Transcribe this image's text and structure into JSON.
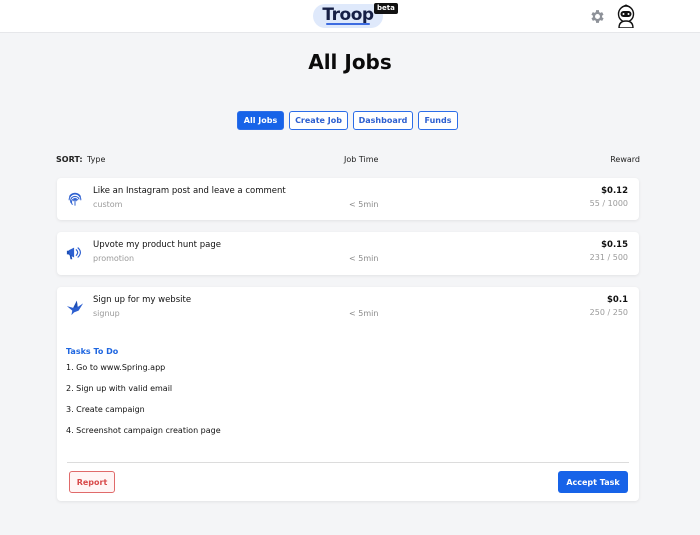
{
  "header": {
    "logo_text": "Troop",
    "beta_label": "beta",
    "settings_icon": "gear-icon",
    "avatar_icon": "astronaut-avatar-icon"
  },
  "page_title": "All Jobs",
  "tabs": [
    {
      "label": "All Jobs",
      "active": true
    },
    {
      "label": "Create Job",
      "active": false
    },
    {
      "label": "Dashboard",
      "active": false
    },
    {
      "label": "Funds",
      "active": false
    }
  ],
  "sort": {
    "label": "SORT:",
    "columns": [
      "Type",
      "Job Time",
      "Reward"
    ]
  },
  "jobs": [
    {
      "icon": "fingerprint-icon",
      "title": "Like an Instagram post and leave a comment",
      "type": "custom",
      "time": "< 5min",
      "reward": "$0.12",
      "count": "55 / 1000"
    },
    {
      "icon": "megaphone-icon",
      "title": "Upvote my product hunt page",
      "type": "promotion",
      "time": "< 5min",
      "reward": "$0.15",
      "count": "231 / 500"
    },
    {
      "icon": "bird-icon",
      "title": "Sign up for my website",
      "type": "signup",
      "time": "< 5min",
      "reward": "$0.1",
      "count": "250 / 250"
    }
  ],
  "expanded": {
    "tasks_heading": "Tasks To Do",
    "tasks": [
      "1. Go to www.Spring.app",
      "2. Sign up with valid email",
      "3. Create campaign",
      "4. Screenshot campaign creation page"
    ],
    "report_label": "Report",
    "accept_label": "Accept Task"
  },
  "colors": {
    "accent": "#1763e8",
    "danger": "#d84a4a",
    "background": "#f4f5f7"
  }
}
